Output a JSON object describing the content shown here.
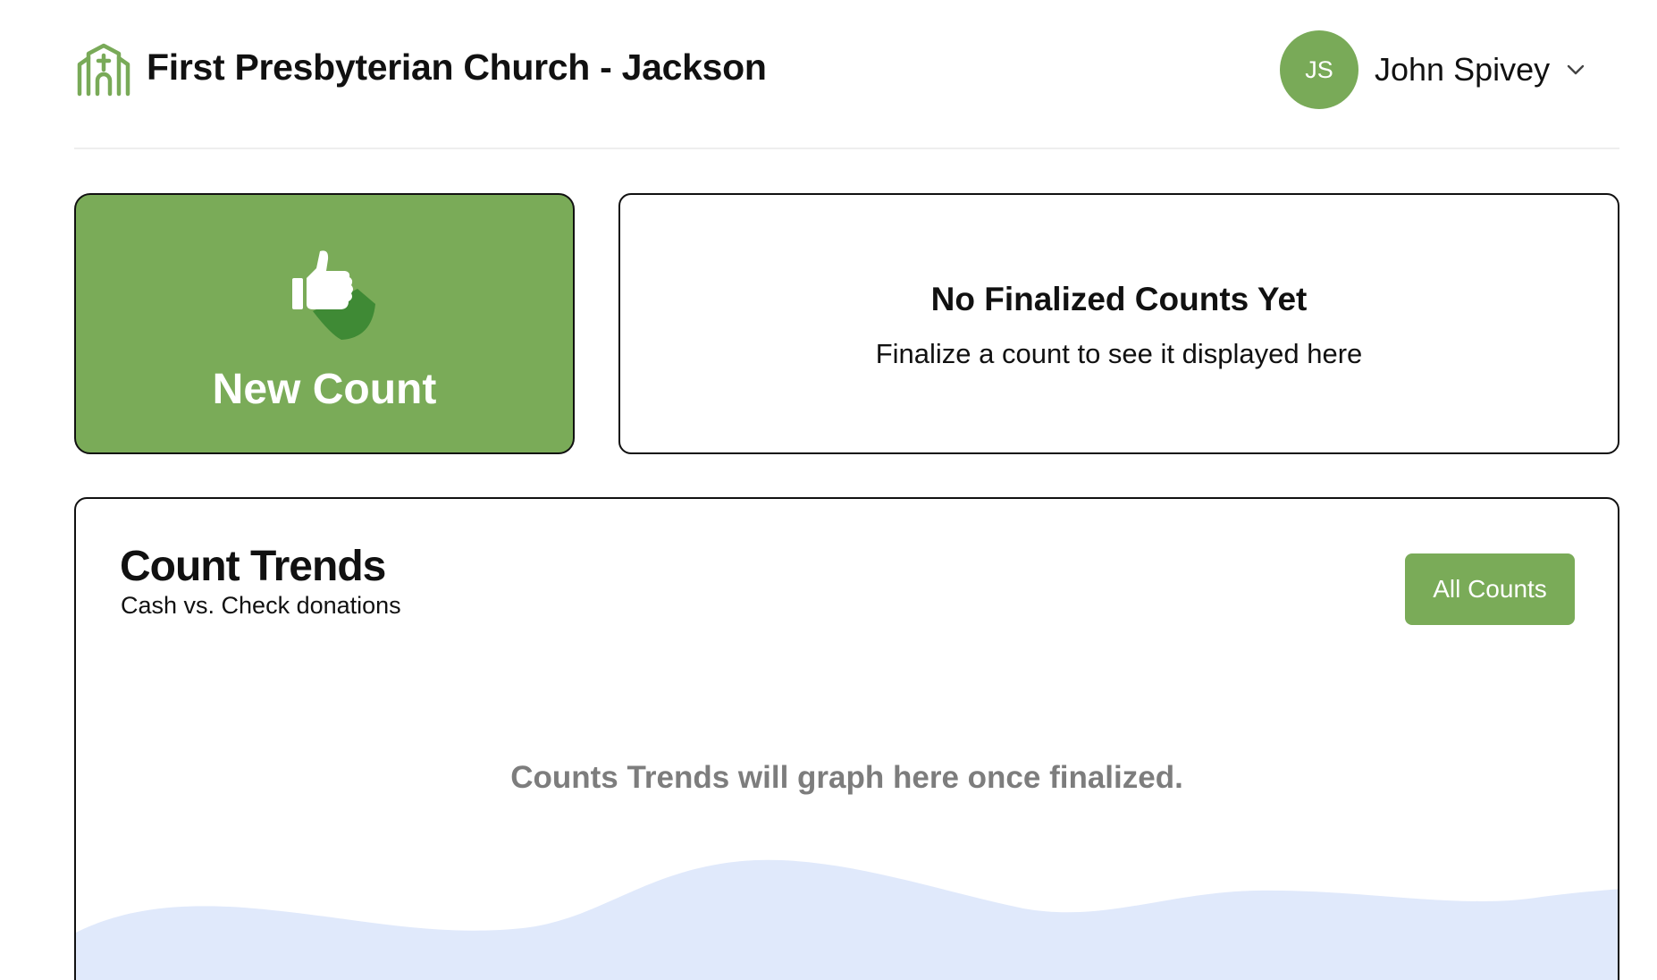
{
  "header": {
    "org_name": "First Presbyterian Church - Jackson",
    "logo_icon": "church-icon",
    "user": {
      "initials": "JS",
      "name": "John Spivey",
      "menu_icon": "chevron-down-icon"
    }
  },
  "new_count_card": {
    "label": "New Count",
    "icon": "thumbs-up-icon"
  },
  "finalized_card": {
    "title": "No Finalized Counts Yet",
    "subtitle": "Finalize a count to see it displayed here"
  },
  "trends": {
    "title": "Count Trends",
    "subtitle": "Cash vs. Check donations",
    "all_counts_label": "All Counts",
    "empty_message": "Counts Trends will graph here once finalized."
  },
  "colors": {
    "brand_green": "#7aab58",
    "dark_green": "#3f8a35",
    "wave_fill": "#e0e9fb",
    "muted_text": "#7d7d7d"
  }
}
